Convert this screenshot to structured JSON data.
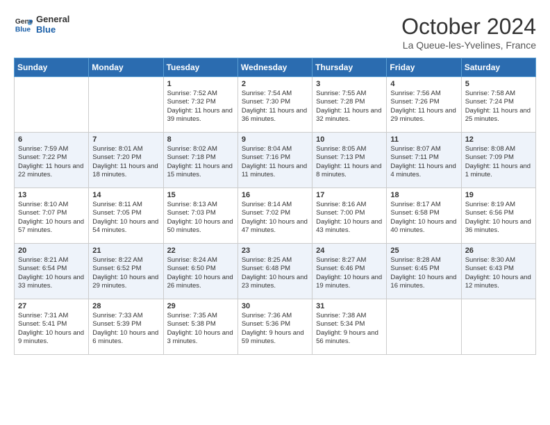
{
  "header": {
    "logo_line1": "General",
    "logo_line2": "Blue",
    "month_title": "October 2024",
    "location": "La Queue-les-Yvelines, France"
  },
  "days_of_week": [
    "Sunday",
    "Monday",
    "Tuesday",
    "Wednesday",
    "Thursday",
    "Friday",
    "Saturday"
  ],
  "weeks": [
    [
      {
        "day": "",
        "content": ""
      },
      {
        "day": "",
        "content": ""
      },
      {
        "day": "1",
        "content": "Sunrise: 7:52 AM\nSunset: 7:32 PM\nDaylight: 11 hours and 39 minutes."
      },
      {
        "day": "2",
        "content": "Sunrise: 7:54 AM\nSunset: 7:30 PM\nDaylight: 11 hours and 36 minutes."
      },
      {
        "day": "3",
        "content": "Sunrise: 7:55 AM\nSunset: 7:28 PM\nDaylight: 11 hours and 32 minutes."
      },
      {
        "day": "4",
        "content": "Sunrise: 7:56 AM\nSunset: 7:26 PM\nDaylight: 11 hours and 29 minutes."
      },
      {
        "day": "5",
        "content": "Sunrise: 7:58 AM\nSunset: 7:24 PM\nDaylight: 11 hours and 25 minutes."
      }
    ],
    [
      {
        "day": "6",
        "content": "Sunrise: 7:59 AM\nSunset: 7:22 PM\nDaylight: 11 hours and 22 minutes."
      },
      {
        "day": "7",
        "content": "Sunrise: 8:01 AM\nSunset: 7:20 PM\nDaylight: 11 hours and 18 minutes."
      },
      {
        "day": "8",
        "content": "Sunrise: 8:02 AM\nSunset: 7:18 PM\nDaylight: 11 hours and 15 minutes."
      },
      {
        "day": "9",
        "content": "Sunrise: 8:04 AM\nSunset: 7:16 PM\nDaylight: 11 hours and 11 minutes."
      },
      {
        "day": "10",
        "content": "Sunrise: 8:05 AM\nSunset: 7:13 PM\nDaylight: 11 hours and 8 minutes."
      },
      {
        "day": "11",
        "content": "Sunrise: 8:07 AM\nSunset: 7:11 PM\nDaylight: 11 hours and 4 minutes."
      },
      {
        "day": "12",
        "content": "Sunrise: 8:08 AM\nSunset: 7:09 PM\nDaylight: 11 hours and 1 minute."
      }
    ],
    [
      {
        "day": "13",
        "content": "Sunrise: 8:10 AM\nSunset: 7:07 PM\nDaylight: 10 hours and 57 minutes."
      },
      {
        "day": "14",
        "content": "Sunrise: 8:11 AM\nSunset: 7:05 PM\nDaylight: 10 hours and 54 minutes."
      },
      {
        "day": "15",
        "content": "Sunrise: 8:13 AM\nSunset: 7:03 PM\nDaylight: 10 hours and 50 minutes."
      },
      {
        "day": "16",
        "content": "Sunrise: 8:14 AM\nSunset: 7:02 PM\nDaylight: 10 hours and 47 minutes."
      },
      {
        "day": "17",
        "content": "Sunrise: 8:16 AM\nSunset: 7:00 PM\nDaylight: 10 hours and 43 minutes."
      },
      {
        "day": "18",
        "content": "Sunrise: 8:17 AM\nSunset: 6:58 PM\nDaylight: 10 hours and 40 minutes."
      },
      {
        "day": "19",
        "content": "Sunrise: 8:19 AM\nSunset: 6:56 PM\nDaylight: 10 hours and 36 minutes."
      }
    ],
    [
      {
        "day": "20",
        "content": "Sunrise: 8:21 AM\nSunset: 6:54 PM\nDaylight: 10 hours and 33 minutes."
      },
      {
        "day": "21",
        "content": "Sunrise: 8:22 AM\nSunset: 6:52 PM\nDaylight: 10 hours and 29 minutes."
      },
      {
        "day": "22",
        "content": "Sunrise: 8:24 AM\nSunset: 6:50 PM\nDaylight: 10 hours and 26 minutes."
      },
      {
        "day": "23",
        "content": "Sunrise: 8:25 AM\nSunset: 6:48 PM\nDaylight: 10 hours and 23 minutes."
      },
      {
        "day": "24",
        "content": "Sunrise: 8:27 AM\nSunset: 6:46 PM\nDaylight: 10 hours and 19 minutes."
      },
      {
        "day": "25",
        "content": "Sunrise: 8:28 AM\nSunset: 6:45 PM\nDaylight: 10 hours and 16 minutes."
      },
      {
        "day": "26",
        "content": "Sunrise: 8:30 AM\nSunset: 6:43 PM\nDaylight: 10 hours and 12 minutes."
      }
    ],
    [
      {
        "day": "27",
        "content": "Sunrise: 7:31 AM\nSunset: 5:41 PM\nDaylight: 10 hours and 9 minutes."
      },
      {
        "day": "28",
        "content": "Sunrise: 7:33 AM\nSunset: 5:39 PM\nDaylight: 10 hours and 6 minutes."
      },
      {
        "day": "29",
        "content": "Sunrise: 7:35 AM\nSunset: 5:38 PM\nDaylight: 10 hours and 3 minutes."
      },
      {
        "day": "30",
        "content": "Sunrise: 7:36 AM\nSunset: 5:36 PM\nDaylight: 9 hours and 59 minutes."
      },
      {
        "day": "31",
        "content": "Sunrise: 7:38 AM\nSunset: 5:34 PM\nDaylight: 9 hours and 56 minutes."
      },
      {
        "day": "",
        "content": ""
      },
      {
        "day": "",
        "content": ""
      }
    ]
  ]
}
